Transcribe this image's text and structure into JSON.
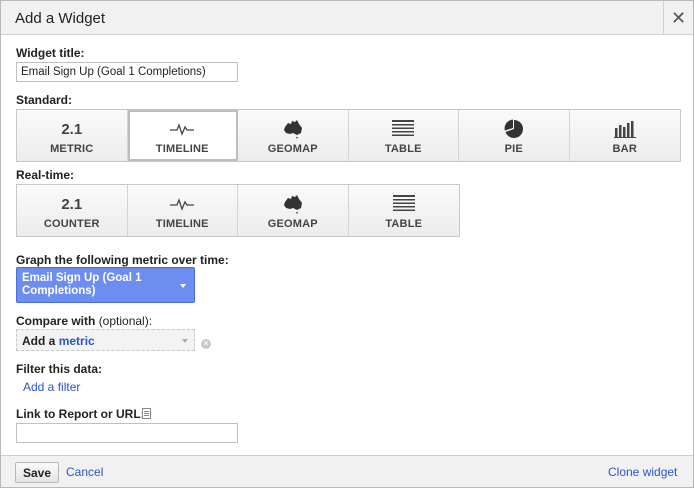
{
  "dialog": {
    "title": "Add a Widget",
    "close_icon": "close-icon"
  },
  "widget_title": {
    "label": "Widget title:",
    "value": "Email Sign Up (Goal 1 Completions)"
  },
  "standard": {
    "label": "Standard:",
    "items": [
      {
        "label": "METRIC",
        "icon_text": "2.1",
        "icon": "metric-icon",
        "selected": false
      },
      {
        "label": "TIMELINE",
        "icon": "timeline-icon",
        "selected": true
      },
      {
        "label": "GEOMAP",
        "icon": "australia-map-icon",
        "selected": false
      },
      {
        "label": "TABLE",
        "icon": "table-icon",
        "selected": false
      },
      {
        "label": "PIE",
        "icon": "pie-icon",
        "selected": false
      },
      {
        "label": "BAR",
        "icon": "bar-chart-icon",
        "selected": false
      }
    ]
  },
  "realtime": {
    "label": "Real-time:",
    "items": [
      {
        "label": "COUNTER",
        "icon_text": "2.1",
        "icon": "counter-icon"
      },
      {
        "label": "TIMELINE",
        "icon": "timeline-icon"
      },
      {
        "label": "GEOMAP",
        "icon": "australia-map-icon"
      },
      {
        "label": "TABLE",
        "icon": "table-icon"
      }
    ]
  },
  "graph_metric": {
    "label": "Graph the following metric over time:",
    "value": "Email Sign Up (Goal 1 Completions)"
  },
  "compare": {
    "label": "Compare with",
    "optional": "(optional):",
    "add_prefix": "Add a",
    "add_link": "metric"
  },
  "filter": {
    "label": "Filter this data:",
    "add_link": "Add a filter"
  },
  "link_report": {
    "label": "Link to Report or URL:",
    "value": ""
  },
  "footer": {
    "save_label": "Save",
    "cancel_label": "Cancel",
    "clone_label": "Clone widget"
  },
  "colors": {
    "accent": "#6d8ef0",
    "link": "#2a56c6"
  }
}
